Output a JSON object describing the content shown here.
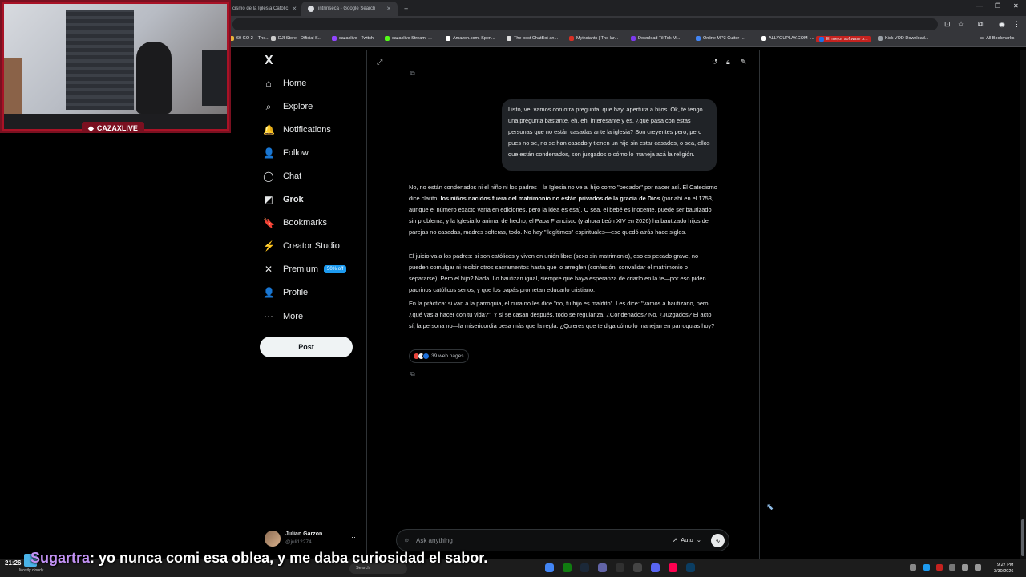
{
  "browser": {
    "tabs": [
      {
        "title": "cismo de la Iglesia Católic"
      },
      {
        "title": "intrínseca - Google Search"
      }
    ],
    "new_tab": "+",
    "bookmarks": [
      {
        "label": "60 GO 2 – The...",
        "color": "#e8b33b"
      },
      {
        "label": "DJI Store - Official S...",
        "color": "#cccccc"
      },
      {
        "label": "cazaxlive - Twitch",
        "color": "#9146ff"
      },
      {
        "label": "cazaxlive Stream -...",
        "color": "#53fc18"
      },
      {
        "label": "Amazon.com. Spen...",
        "color": "#ffffff"
      },
      {
        "label": "The best ChatBot an...",
        "color": "#dddddd"
      },
      {
        "label": "Myinstants | The lar...",
        "color": "#d93025"
      },
      {
        "label": "Download TikTok M...",
        "color": "#7c3aed"
      },
      {
        "label": "Online MP3 Cutter -...",
        "color": "#4285f4"
      },
      {
        "label": "ALLYOUPLAY.COM -...",
        "color": "#ffffff"
      },
      {
        "label": "El mejor software p...",
        "color": "#1a73e8"
      },
      {
        "label": "Kick VOD Download...",
        "color": "#9aa0a6"
      }
    ],
    "all_bookmarks": "All Bookmarks"
  },
  "webcam": {
    "brand": "CAZAXLIVE"
  },
  "sidebar": {
    "logo": "X",
    "items": [
      {
        "label": "Home",
        "icon": "home-icon",
        "glyph": "⌂"
      },
      {
        "label": "Explore",
        "icon": "search-icon",
        "glyph": "⌕"
      },
      {
        "label": "Notifications",
        "icon": "bell-icon",
        "glyph": "🔔"
      },
      {
        "label": "Follow",
        "icon": "person-plus-icon",
        "glyph": "👤"
      },
      {
        "label": "Chat",
        "icon": "chat-bubble-icon",
        "glyph": "◯"
      },
      {
        "label": "Grok",
        "icon": "grok-icon",
        "glyph": "◩"
      },
      {
        "label": "Bookmarks",
        "icon": "bookmark-icon",
        "glyph": "🔖"
      },
      {
        "label": "Creator Studio",
        "icon": "lightning-icon",
        "glyph": "⚡"
      },
      {
        "label": "Premium",
        "icon": "x-premium-icon",
        "glyph": "✕"
      },
      {
        "label": "Profile",
        "icon": "person-icon",
        "glyph": "👤"
      },
      {
        "label": "More",
        "icon": "more-circle-icon",
        "glyph": "⋯"
      }
    ],
    "premium_badge": "50% off",
    "post_label": "Post",
    "profile": {
      "name": "Julian Garzon",
      "handle": "@juli12274"
    }
  },
  "conversation": {
    "user_message": "Listo, ve, vamos con otra pregunta, que hay, apertura a hijos. Ok, te tengo una pregunta bastante, eh, eh, interesante y es, ¿qué pasa con estas personas que no están casadas ante la iglesia? Son creyentes pero, pero pues no se, no se han casado y tienen un hijo sin estar casados, o sea, ellos que están condenados, son juzgados o cómo lo maneja acá la religión.",
    "answer": {
      "p1_a": "No, no están condenados ni el niño ni los padres—la Iglesia no ve al hijo como \"pecador\" por nacer así. El Catecismo dice clarito: ",
      "p1_bold": "los niños nacidos fuera del matrimonio no están privados de la gracia de Dios",
      "p1_b": " (por ahí en el 1753, aunque el número exacto varía en ediciones, pero la idea es esa). O sea, el bebé es inocente, puede ser bautizado sin problema, y la Iglesia lo anima: de hecho, el Papa Francisco (y ahora León XIV en 2026) ha bautizado hijos de parejas no casadas, madres solteras, todo. No hay \"ilegítimos\" espirituales—eso quedó atrás hace siglos.",
      "p2": "El juicio va a los padres: si son católicos y viven en unión libre (sexo sin matrimonio), eso es pecado grave, no pueden comulgar ni recibir otros sacramentos hasta que lo arreglen (confesión, convalidar el matrimonio o separarse). Pero el hijo? Nada. Lo bautizan igual, siempre que haya esperanza de criarlo en la fe—por eso piden padrinos católicos serios, y que los papás prometan educarlo cristiano.",
      "p3": "En la práctica: si van a la parroquia, el cura no les dice \"no, tu hijo es maldito\". Les dice: \"vamos a bautizarlo, pero ¿qué vas a hacer con tu vida?\". Y si se casan después, todo se regulariza. ¿Condenados? No. ¿Juzgados? El acto sí, la persona no—la misericordia pesa más que la regla. ¿Quieres que te diga cómo lo manejan en parroquias hoy?"
    },
    "sources_label": "39 web pages"
  },
  "composer": {
    "placeholder": "Ask anything",
    "mode": "Auto"
  },
  "taskbar": {
    "time_left": "21:26",
    "weather": "Mostly cloudy",
    "search_placeholder": "Search",
    "clock_time": "9:27 PM",
    "clock_date": "3/30/2026"
  },
  "stream_chat": {
    "user": "Sugartra",
    "message": ": yo nunca comi esa oblea, y me daba curiosidad el sabor."
  }
}
